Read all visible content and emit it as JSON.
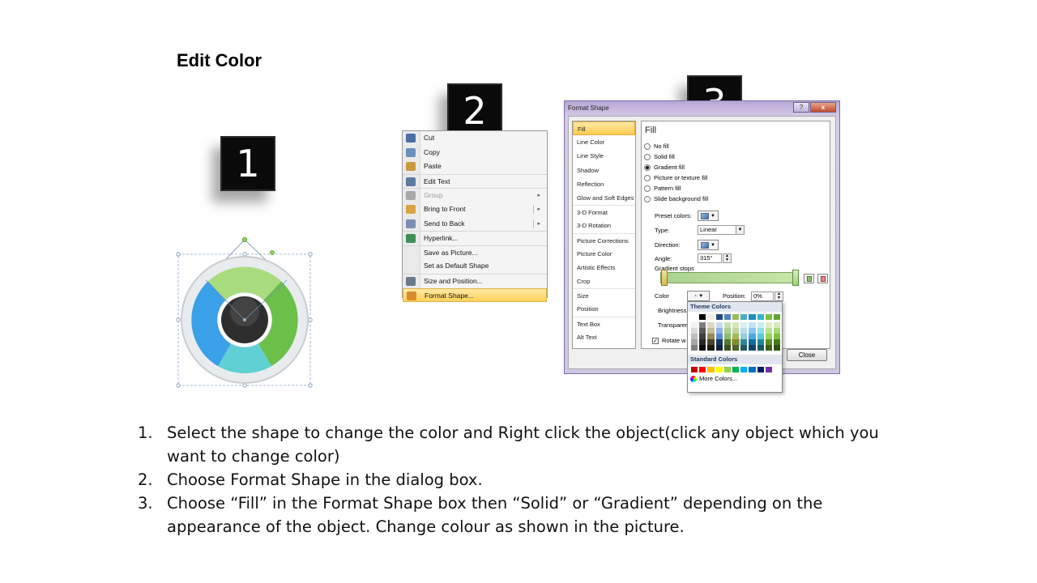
{
  "slide": {
    "title": "Edit Color"
  },
  "badges": [
    "1",
    "2",
    "3"
  ],
  "context_menu": {
    "items": [
      {
        "label": "Cut",
        "icon": "scissors-icon",
        "icon_color": "#4a6fa5"
      },
      {
        "label": "Copy",
        "icon": "copy-icon",
        "icon_color": "#6a8fbf"
      },
      {
        "label": "Paste",
        "icon": "paste-icon",
        "icon_color": "#c89b3c"
      },
      {
        "label": "Edit Text",
        "icon": "edit-text-icon",
        "icon_color": "#5a7aa0"
      },
      {
        "label": "Group",
        "icon": "group-icon",
        "icon_color": "#a8a8a8",
        "disabled": true,
        "submenu": true
      },
      {
        "label": "Bring to Front",
        "icon": "bring-front-icon",
        "icon_color": "#d9a441",
        "submenu": true
      },
      {
        "label": "Send to Back",
        "icon": "send-back-icon",
        "icon_color": "#7b8fb2",
        "submenu": true
      },
      {
        "label": "Hyperlink...",
        "icon": "hyperlink-icon",
        "icon_color": "#3f8f5a"
      },
      {
        "label": "Save as Picture...",
        "icon": "",
        "icon_color": ""
      },
      {
        "label": "Set as Default Shape",
        "icon": "",
        "icon_color": ""
      },
      {
        "label": "Size and Position...",
        "icon": "size-position-icon",
        "icon_color": "#6a7a8a"
      },
      {
        "label": "Format Shape...",
        "icon": "format-shape-icon",
        "icon_color": "#d98c2b",
        "highlighted": true
      }
    ]
  },
  "dialog": {
    "title": "Format Shape",
    "title_buttons": [
      "?",
      "x"
    ],
    "nav": [
      "Fill",
      "Line Color",
      "Line Style",
      "Shadow",
      "Reflection",
      "Glow and Soft Edges",
      "3-D Format",
      "3-D Rotation",
      "Picture Corrections",
      "Picture Color",
      "Artistic Effects",
      "Crop",
      "Size",
      "Position",
      "Text Box",
      "Alt Text"
    ],
    "panel_title": "Fill",
    "fill_options": [
      "No fill",
      "Solid fill",
      "Gradient fill",
      "Picture or texture fill",
      "Pattern fill",
      "Slide background fill"
    ],
    "preset_label": "Preset colors:",
    "type_label": "Type:",
    "type_value": "Linear",
    "direction_label": "Direction:",
    "angle_label": "Angle:",
    "angle_value": "315°",
    "stops_label": "Gradient stops",
    "color_label": "Color",
    "position_label": "Position:",
    "position_value": "0%",
    "brightness_label": "Brightness",
    "transparency_label": "Transparen",
    "rotate_label": "Rotate w",
    "close_label": "Close"
  },
  "picker": {
    "theme_label": "Theme Colors",
    "standard_label": "Standard Colors",
    "more_label": "More Colors...",
    "theme_top": [
      "#ffffff",
      "#000000",
      "#eeece1",
      "#1f497d",
      "#4f81bd",
      "#9bbb59",
      "#4bacc6",
      "#1f8fc1",
      "#31b4c9",
      "#7ac043",
      "#5ea531"
    ],
    "theme_rows": [
      [
        "#f2f2f2",
        "#7f7f7f",
        "#ddd9c3",
        "#c6d9f0",
        "#c5e0b3",
        "#d7e4bc",
        "#dbeef3",
        "#c3e3f4",
        "#c8eef2",
        "#dcf0c6",
        "#d2ecbc"
      ],
      [
        "#d9d9d9",
        "#595959",
        "#c4bd97",
        "#8db3e2",
        "#a9d08e",
        "#c3d69b",
        "#b7dde8",
        "#88c7ea",
        "#92dce6",
        "#b9e18f",
        "#a6d97a"
      ],
      [
        "#bfbfbf",
        "#3f3f3f",
        "#938953",
        "#548dd4",
        "#8cbc6a",
        "#9bbb59",
        "#92cddc",
        "#4ca9dd",
        "#5bc9d9",
        "#97d358",
        "#7dc53b"
      ],
      [
        "#a5a5a5",
        "#262626",
        "#494429",
        "#17365d",
        "#4f7a31",
        "#76923c",
        "#31859b",
        "#166b98",
        "#218796",
        "#5a8f24",
        "#467b1d"
      ],
      [
        "#7f7f7f",
        "#0c0c0c",
        "#1d1b10",
        "#0f243e",
        "#35521f",
        "#4f6128",
        "#205867",
        "#0e4766",
        "#165a64",
        "#3c5f18",
        "#2f5213"
      ]
    ],
    "selected_row": 3,
    "selected_col": 5,
    "standard": [
      "#c00000",
      "#ff0000",
      "#ffc000",
      "#ffff00",
      "#92d050",
      "#00b050",
      "#00b0f0",
      "#0070c0",
      "#002060",
      "#7030a0"
    ]
  },
  "instructions": [
    "Select the shape to change the color and Right click the object(click any object which you want to change color)",
    "Choose Format Shape in the dialog box.",
    "Choose “Fill” in the Format Shape box then “Solid” or “Gradient” depending on the appearance of the object. Change colour as shown in the picture."
  ],
  "colors": {
    "ring_green_light": "#a9dc7e",
    "ring_green": "#6cc04a",
    "ring_blue": "#3aa0e8",
    "ring_teal": "#5fd0d3",
    "center_dark": "#333333"
  }
}
